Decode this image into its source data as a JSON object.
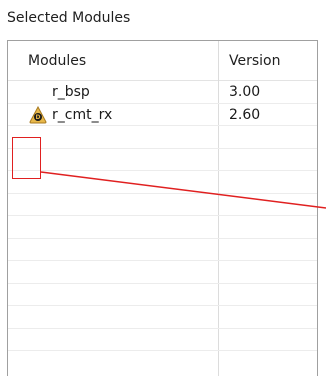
{
  "section": {
    "title": "Selected Modules"
  },
  "table": {
    "columns": [
      "Modules",
      "Version"
    ],
    "rows": [
      {
        "name": "r_bsp",
        "version": "3.00",
        "icon": null
      },
      {
        "name": "r_cmt_rx",
        "version": "2.60",
        "icon": "download-badge-icon"
      },
      {
        "name": "",
        "version": "",
        "icon": null
      },
      {
        "name": "",
        "version": "",
        "icon": null
      },
      {
        "name": "",
        "version": "",
        "icon": null
      },
      {
        "name": "",
        "version": "",
        "icon": null
      },
      {
        "name": "",
        "version": "",
        "icon": null
      },
      {
        "name": "",
        "version": "",
        "icon": null
      },
      {
        "name": "",
        "version": "",
        "icon": null
      },
      {
        "name": "",
        "version": "",
        "icon": null
      },
      {
        "name": "",
        "version": "",
        "icon": null
      },
      {
        "name": "",
        "version": "",
        "icon": null
      }
    ]
  },
  "icons": {
    "badge_letter": "D"
  },
  "colors": {
    "annotation": "#e02020",
    "badge_fill": "#e8b84a"
  }
}
